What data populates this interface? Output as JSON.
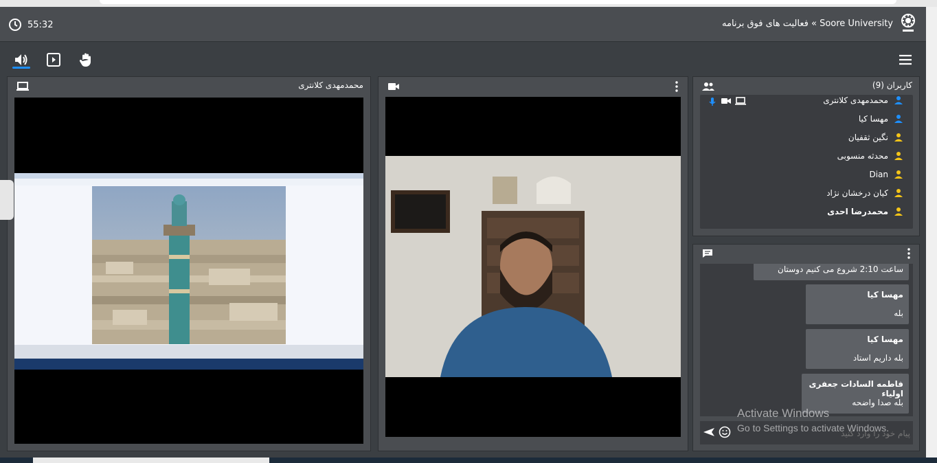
{
  "header": {
    "timer": "55:32",
    "title": "Soore University » فعالیت های فوق برنامه"
  },
  "toolbar": {
    "items": [
      {
        "icon": "speaker-icon",
        "active": true
      },
      {
        "icon": "presentation-icon",
        "active": false
      },
      {
        "icon": "raise-hand-icon",
        "active": false
      }
    ],
    "menu_icon": "hamburger-menu-icon"
  },
  "screenshare": {
    "title": "محمدمهدی کلانتری",
    "icon": "laptop-icon"
  },
  "camera": {
    "icon": "video-camera-icon",
    "menu_icon": "more-vertical-icon"
  },
  "users": {
    "title": "کاربران (9)",
    "items": [
      {
        "name": "محمدمهدی کلانتری",
        "color": "#1e90ff",
        "bold": false,
        "icons": [
          "microphone-icon",
          "video-camera-icon",
          "laptop-icon"
        ]
      },
      {
        "name": "مهسا کیا",
        "color": "#1e90ff",
        "bold": false,
        "icons": []
      },
      {
        "name": "نگین ثقفیان",
        "color": "#f5c518",
        "bold": false,
        "icons": []
      },
      {
        "name": "محدثه منسوبی",
        "color": "#f5c518",
        "bold": false,
        "icons": []
      },
      {
        "name": "Dian",
        "color": "#f5c518",
        "bold": false,
        "icons": []
      },
      {
        "name": "کیان درخشان نژاد",
        "color": "#f5c518",
        "bold": false,
        "icons": []
      },
      {
        "name": "محمدرضا احدی",
        "color": "#f5c518",
        "bold": true,
        "icons": []
      }
    ]
  },
  "chat": {
    "messages": [
      {
        "sender": "",
        "text": "ساعت 2:10 شروع می کنیم دوستان"
      },
      {
        "sender": "مهسا کیا",
        "text": "بله"
      },
      {
        "sender": "مهسا کیا",
        "text": "بله داریم استاد"
      },
      {
        "sender": "فاطمه السادات جعفری اولیاء",
        "text": "بله صدا واضحه"
      }
    ],
    "input_placeholder": "پیام خود را وارد کنید",
    "send_icon": "send-icon",
    "emoji_icon": "emoji-icon"
  },
  "watermark": {
    "line1": "Activate Windows",
    "line2": "Go to Settings to activate Windows."
  }
}
